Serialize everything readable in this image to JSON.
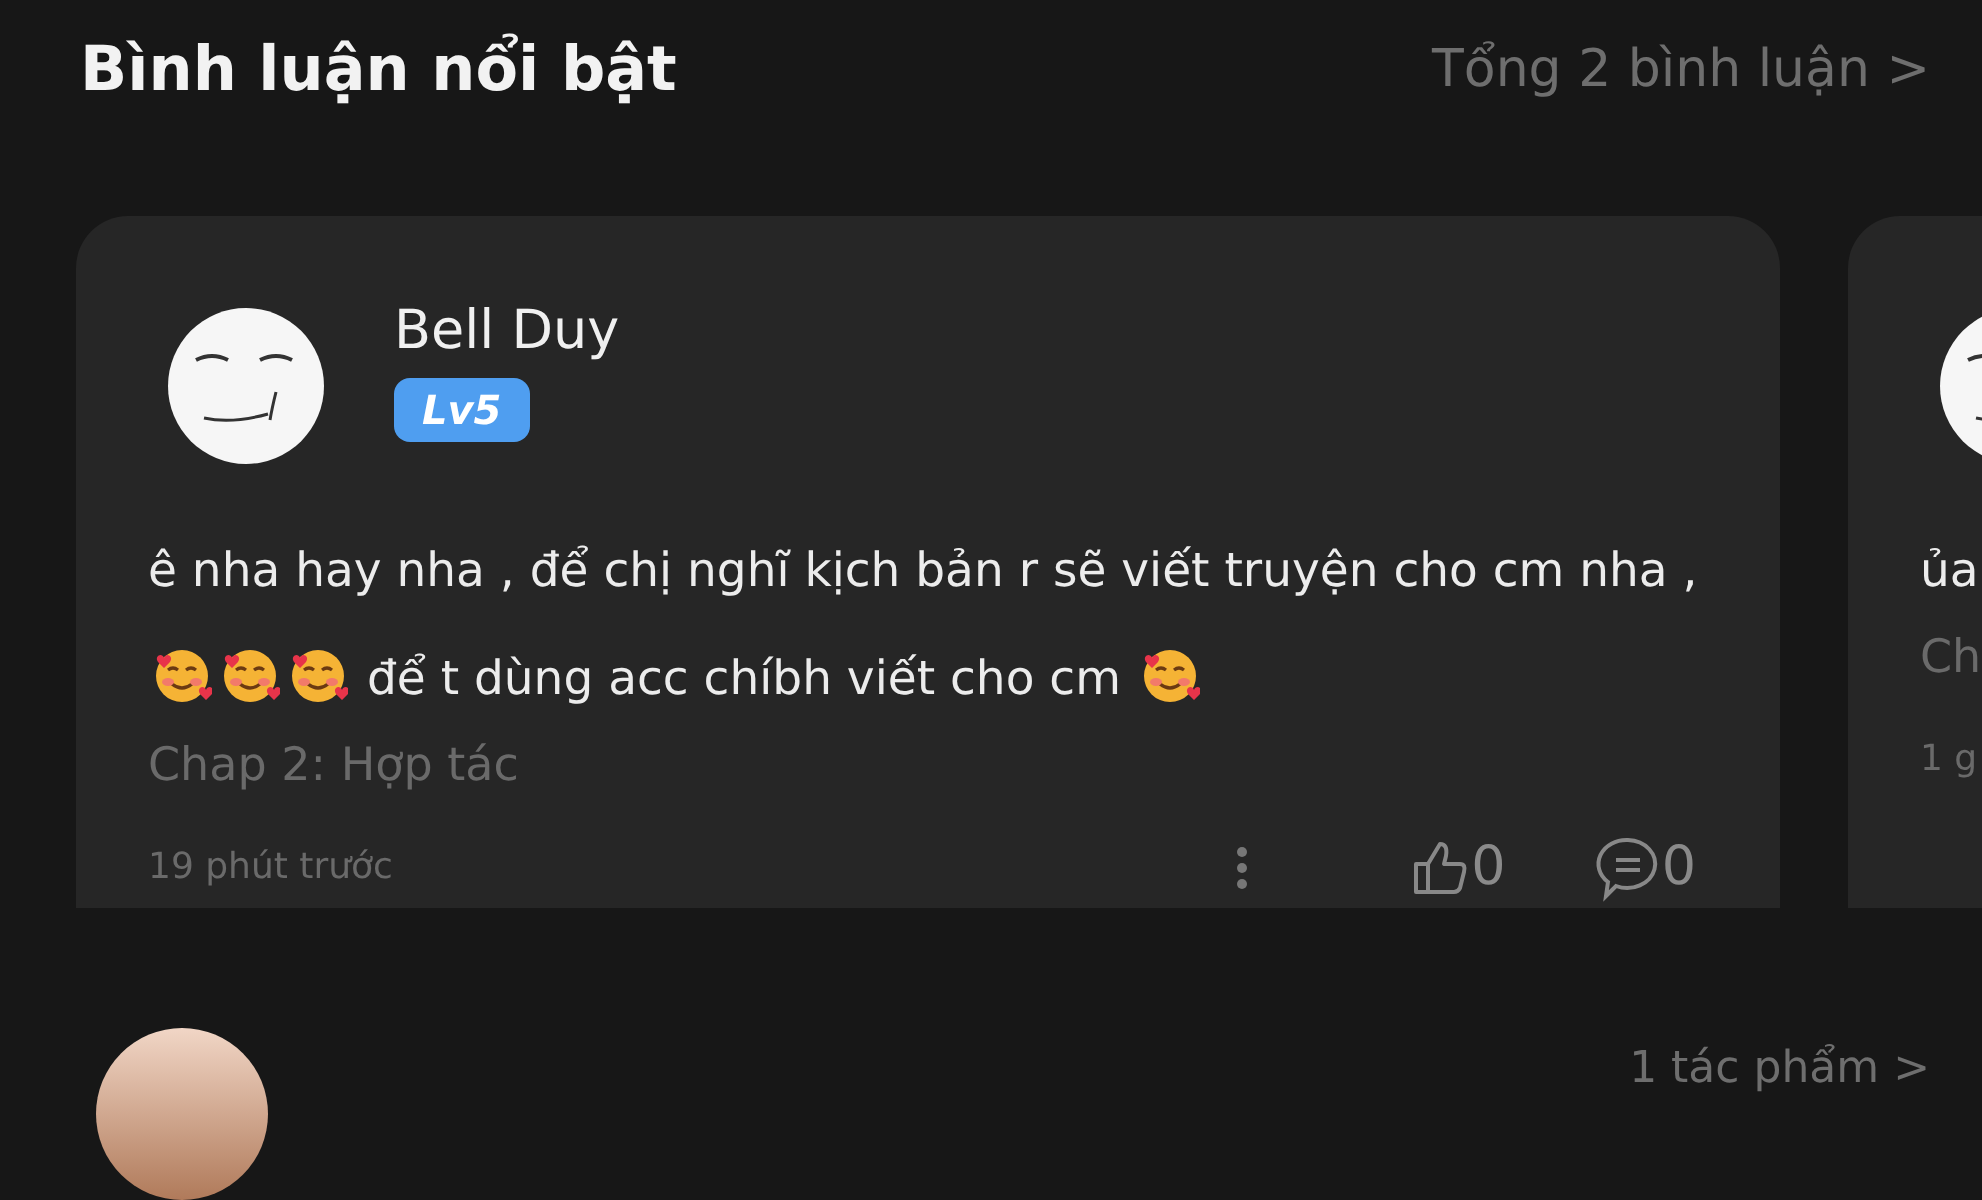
{
  "header": {
    "title": "Bình luận nổi bật",
    "total_link": "Tổng 2 bình luận >"
  },
  "comments": [
    {
      "author": "Bell Duy",
      "level_badge": "Lv5",
      "comment": [
        {
          "kind": "text",
          "text": "ê nha hay nha , để chị nghĩ kịch bản r sẽ viết truyện cho cm nha , "
        },
        {
          "kind": "emoji"
        },
        {
          "kind": "emoji"
        },
        {
          "kind": "emoji"
        },
        {
          "kind": "text",
          "text": " để t dùng acc chíbh viết cho cm "
        },
        {
          "kind": "emoji"
        }
      ],
      "chapter": "Chap 2: Hợp tác",
      "time": "19 phút trước",
      "likes": "0",
      "replies": "0"
    },
    {
      "comment": [
        {
          "kind": "text",
          "text": "ủa"
        }
      ],
      "chapter": "Ch",
      "time": "1 g"
    }
  ],
  "profile": {
    "works_link": "1 tác phẩm >"
  }
}
